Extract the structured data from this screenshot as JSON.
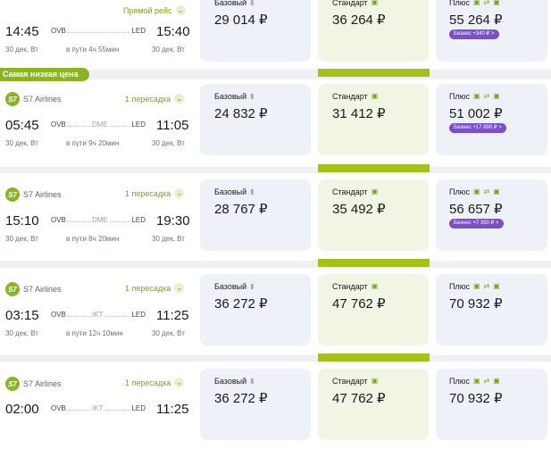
{
  "colors": {
    "accent_green": "#8ab32a",
    "standard_bar": "#a3c11a",
    "business_badge": "#7b4fc9"
  },
  "flights": [
    {
      "airline": "",
      "stops": "Прямой рейс",
      "dep_time": "14:45",
      "arr_time": "15:40",
      "from": "OVB",
      "via": "",
      "to": "LED",
      "dep_date": "30 дек, Вт",
      "arr_date": "30 дек, Вт",
      "duration": "в пути 4ч 55мин",
      "fares": {
        "basic": {
          "label": "Базовый",
          "price": "29 014 ₽"
        },
        "standard": {
          "label": "Стандарт",
          "price": "36 264 ₽"
        },
        "plus": {
          "label": "Плюс",
          "price": "55 264 ₽",
          "upsell": "Бизнес +340 ₽ >"
        }
      }
    },
    {
      "badge": "Самая низкая цена",
      "airline": "S7 Airlines",
      "stops": "1 пересадка",
      "dep_time": "05:45",
      "arr_time": "11:05",
      "from": "OVB",
      "via": "DME",
      "to": "LED",
      "dep_date": "30 дек, Вт",
      "arr_date": "30 дек, Вт",
      "duration": "в пути 9ч 20мин",
      "fares": {
        "basic": {
          "label": "Базовый",
          "price": "24 832 ₽"
        },
        "standard": {
          "label": "Стандарт",
          "price": "31 412 ₽"
        },
        "plus": {
          "label": "Плюс",
          "price": "51 002 ₽",
          "upsell": "Бизнес +17 890 ₽ >"
        }
      }
    },
    {
      "airline": "S7 Airlines",
      "stops": "1 пересадка",
      "dep_time": "15:10",
      "arr_time": "19:30",
      "from": "OVB",
      "via": "DME",
      "to": "LED",
      "dep_date": "30 дек, Вт",
      "arr_date": "30 дек, Вт",
      "duration": "в пути 8ч 20мин",
      "fares": {
        "basic": {
          "label": "Базовый",
          "price": "28 767 ₽"
        },
        "standard": {
          "label": "Стандарт",
          "price": "35 492 ₽"
        },
        "plus": {
          "label": "Плюс",
          "price": "56 657 ₽",
          "upsell": "Бизнес +7 350 ₽ >"
        }
      }
    },
    {
      "airline": "S7 Airlines",
      "stops": "1 пересадка",
      "dep_time": "03:15",
      "arr_time": "11:25",
      "from": "OVB",
      "via": "IKT",
      "to": "LED",
      "dep_date": "30 дек, Вт",
      "arr_date": "30 дек, Вт",
      "duration": "в пути 12ч 10мин",
      "fares": {
        "basic": {
          "label": "Базовый",
          "price": "36 272 ₽"
        },
        "standard": {
          "label": "Стандарт",
          "price": "47 762 ₽"
        },
        "plus": {
          "label": "Плюс",
          "price": "70 932 ₽"
        }
      }
    },
    {
      "airline": "S7 Airlines",
      "stops": "1 пересадка",
      "dep_time": "02:00",
      "arr_time": "11:25",
      "from": "OVB",
      "via": "IKT",
      "to": "LED",
      "fares": {
        "basic": {
          "label": "Базовый",
          "price": "36 272 ₽"
        },
        "standard": {
          "label": "Стандарт",
          "price": "47 762 ₽"
        },
        "plus": {
          "label": "Плюс",
          "price": "70 932 ₽"
        }
      }
    }
  ]
}
